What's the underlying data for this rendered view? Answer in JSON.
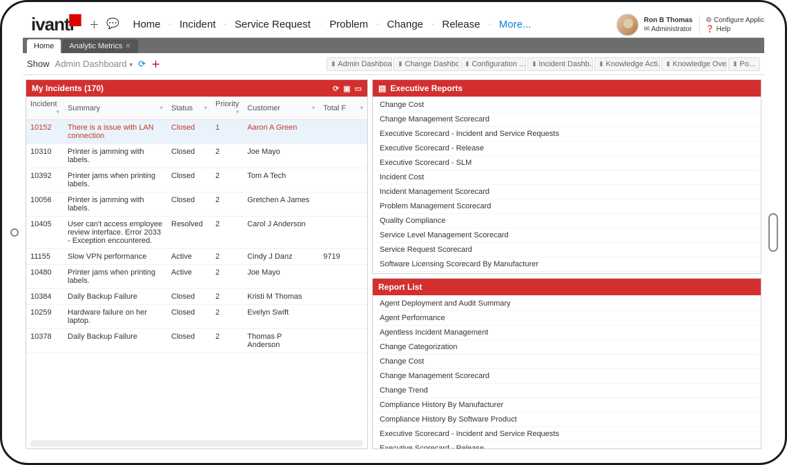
{
  "logo": "ivanti",
  "topnav": [
    "Home",
    "Incident",
    "Service Request",
    "Problem",
    "Change",
    "Release"
  ],
  "topnav_more": "More...",
  "user": {
    "name": "Ron B Thomas",
    "role": "Administrator"
  },
  "config": {
    "configure": "Configure Applic",
    "help": "Help"
  },
  "tabs": [
    {
      "label": "Home",
      "active": true
    },
    {
      "label": "Analytic Metrics",
      "active": false,
      "closable": true
    }
  ],
  "subbar": {
    "show": "Show",
    "dashboard_name": "Admin Dashboard",
    "shortcuts": [
      "Admin Dashboard",
      "Change Dashboa...",
      "Configuration ...",
      "Incident Dashb...",
      "Knowledge Acti...",
      "Knowledge Over...",
      "Po..."
    ]
  },
  "incidents_panel": {
    "title": "My Incidents (170)",
    "columns": [
      "Incident",
      "Summary",
      "Status",
      "Priority",
      "Customer",
      "Total F"
    ],
    "rows": [
      {
        "incident": "10152",
        "summary": "There is a issue with LAN connection",
        "status": "Closed",
        "priority": "1",
        "customer": "Aaron A Green",
        "total": "",
        "selected": true
      },
      {
        "incident": "10310",
        "summary": "Printer is jamming with labels.",
        "status": "Closed",
        "priority": "2",
        "customer": "Joe Mayo",
        "total": ""
      },
      {
        "incident": "10392",
        "summary": "Printer jams when printing labels.",
        "status": "Closed",
        "priority": "2",
        "customer": "Tom A Tech",
        "total": ""
      },
      {
        "incident": "10056",
        "summary": "Printer is jamming with labels.",
        "status": "Closed",
        "priority": "2",
        "customer": "Gretchen A James",
        "total": ""
      },
      {
        "incident": "10405",
        "summary": "User can't access employee review interface. Error 2033 - Exception encountered.",
        "status": "Resolved",
        "priority": "2",
        "customer": "Carol J Anderson",
        "total": ""
      },
      {
        "incident": "11155",
        "summary": "Slow VPN performance",
        "status": "Active",
        "priority": "2",
        "customer": "Cindy J Danz",
        "total": "9719"
      },
      {
        "incident": "10480",
        "summary": "Printer jams when printing labels.",
        "status": "Active",
        "priority": "2",
        "customer": "Joe Mayo",
        "total": ""
      },
      {
        "incident": "10384",
        "summary": "Daily Backup Failure",
        "status": "Closed",
        "priority": "2",
        "customer": "Kristi M Thomas",
        "total": ""
      },
      {
        "incident": "10259",
        "summary": "Hardware failure on her laptop.",
        "status": "Closed",
        "priority": "2",
        "customer": "Evelyn Swift",
        "total": ""
      },
      {
        "incident": "10378",
        "summary": "Daily Backup Failure",
        "status": "Closed",
        "priority": "2",
        "customer": "Thomas P Anderson",
        "total": ""
      }
    ]
  },
  "exec_reports": {
    "title": "Executive Reports",
    "items": [
      "Change Cost",
      "Change Management Scorecard",
      "Executive Scorecard - Incident and Service Requests",
      "Executive Scorecard - Release",
      "Executive Scorecard - SLM",
      "Incident Cost",
      "Incident Management Scorecard",
      "Problem Management Scorecard",
      "Quality Compliance",
      "Service Level Management Scorecard",
      "Service Request Scorecard",
      "Software Licensing Scorecard By Manufacturer"
    ]
  },
  "report_list": {
    "title": "Report List",
    "items": [
      "Agent Deployment and Audit Summary",
      "Agent Performance",
      "Agentless Incident Management",
      "Change Categorization",
      "Change Cost",
      "Change Management Scorecard",
      "Change Trend",
      "Compliance History By Manufacturer",
      "Compliance History By Software Product",
      "Executive Scorecard - Incident and Service Requests",
      "Executive Scorecard - Release"
    ]
  }
}
